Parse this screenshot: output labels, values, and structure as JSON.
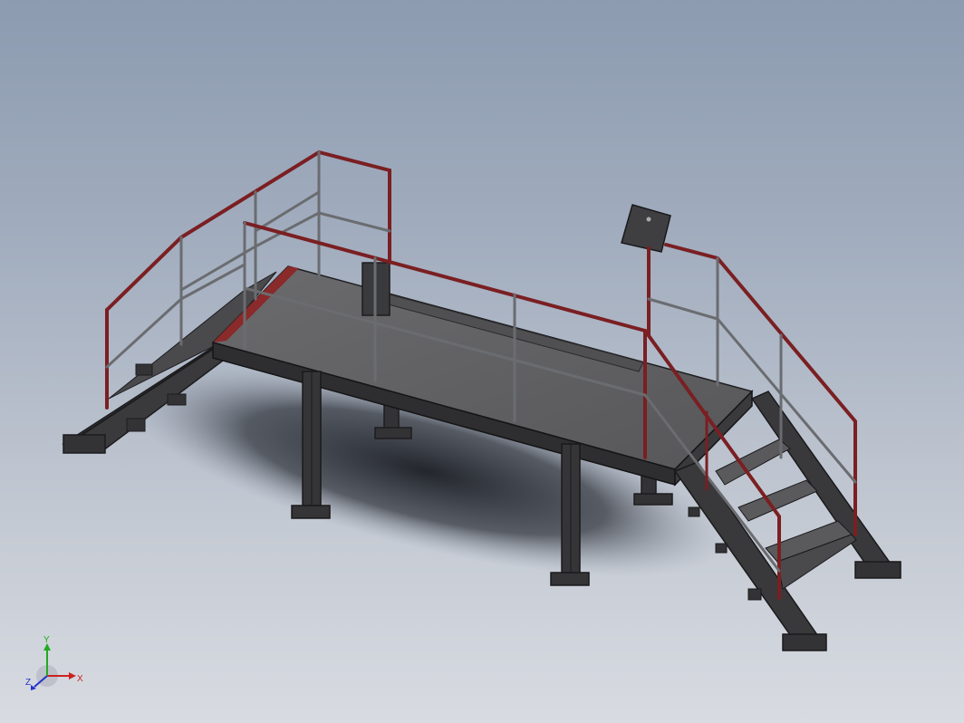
{
  "viewport": {
    "background_top": "#8c9bb0",
    "background_bottom": "#d8dbe1"
  },
  "model": {
    "colors": {
      "steel": "#3b3b3d",
      "steel_dark": "#252527",
      "deck": "#5e5e60",
      "deck_light": "#707072",
      "rail_red": "#7a1f22",
      "rail_grey": "#6a6c70",
      "shadow": "#1f2227"
    }
  },
  "triad": {
    "x_label": "X",
    "y_label": "Y",
    "z_label": "Z",
    "x_color": "#cc2222",
    "y_color": "#22aa22",
    "z_color": "#2233cc"
  }
}
